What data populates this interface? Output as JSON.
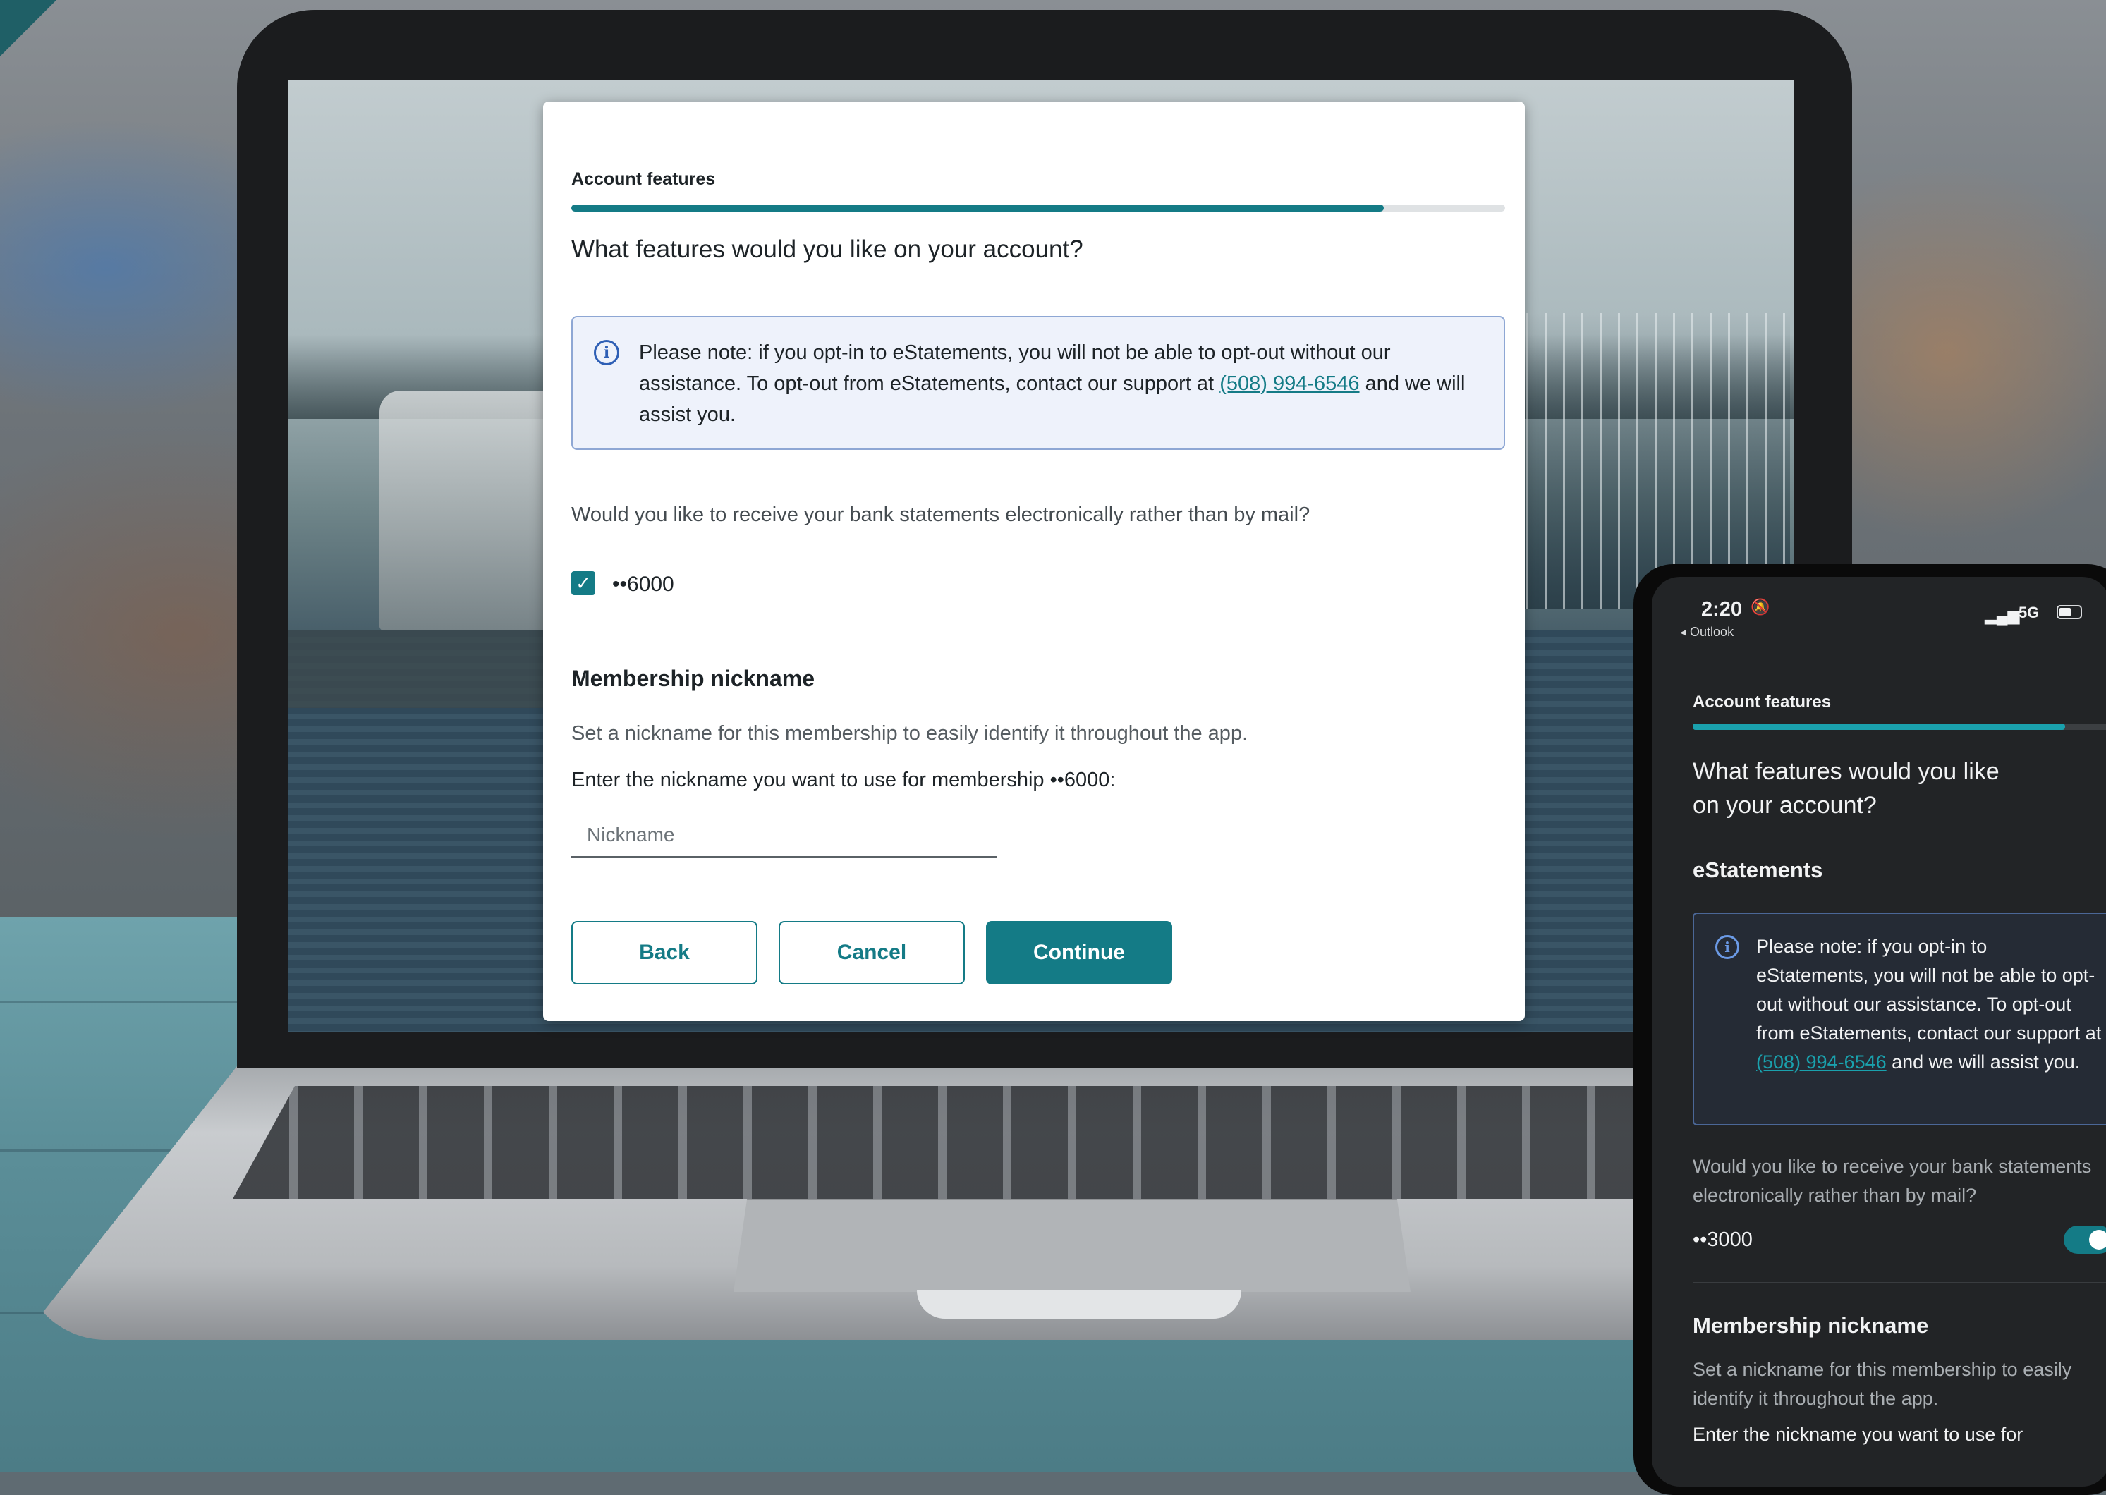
{
  "desktop": {
    "eyebrow": "Account features",
    "progress_fraction": 0.87,
    "question": "What features would you like on your account?",
    "note": {
      "icon": "info-icon",
      "text_before": "Please note: if you opt-in to eStatements, you will not be able to opt-out without our assistance. To opt-out from eStatements, contact our support at ",
      "phone": "(508) 994-6546",
      "text_after": " and we will assist you."
    },
    "mail_question": "Would you like to receive your bank statements electronically rather than by mail?",
    "account": {
      "label": "••6000",
      "checked": true
    },
    "nickname": {
      "title": "Membership nickname",
      "description": "Set a nickname for this membership to easily identify it throughout the app.",
      "label": "Enter the nickname you want to use for membership ••6000:",
      "placeholder": "Nickname",
      "value": ""
    },
    "buttons": {
      "back": "Back",
      "cancel": "Cancel",
      "continue": "Continue"
    }
  },
  "phone": {
    "status": {
      "time": "2:20",
      "back_app": "◂ Outlook",
      "network": "5G",
      "bell_icon": "bell-muted-icon"
    },
    "eyebrow": "Account features",
    "progress_fraction": 0.88,
    "question": "What features would you like on your account?",
    "section": "eStatements",
    "note": {
      "icon": "info-icon",
      "text_before": "Please note: if you opt-in to eStatements, you will not be able to opt-out without our assistance. To opt-out from eStatements, contact our support at ",
      "phone": "(508) 994-6546",
      "text_after": " and we will assist you."
    },
    "mail_question": "Would you like to receive your bank statements electronically rather than by mail?",
    "account": {
      "label": "••3000",
      "enabled": true
    },
    "nickname": {
      "title": "Membership nickname",
      "description": "Set a nickname for this membership to easily identify it throughout the app.",
      "label": "Enter the nickname you want to use for"
    }
  },
  "colors": {
    "accent": "#147b86",
    "info_border": "#8ea7d4",
    "info_bg": "#eef2fb"
  }
}
